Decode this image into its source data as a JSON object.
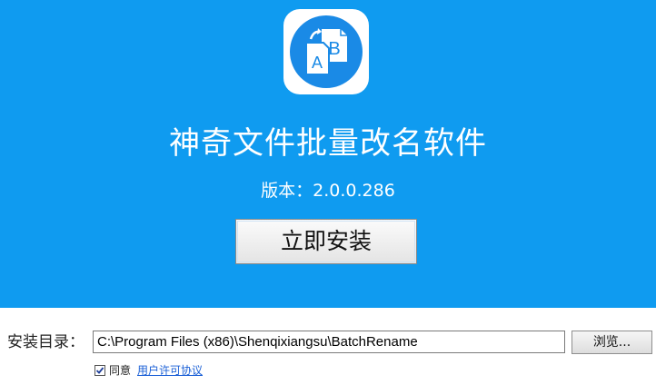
{
  "app": {
    "icon": "document-a-b-icon",
    "title": "神奇文件批量改名软件",
    "version": "版本：2.0.0.286"
  },
  "actions": {
    "install_label": "立即安装"
  },
  "install_dir": {
    "label": "安装目录：",
    "value": "C:\\Program Files (x86)\\Shenqixiangsu\\BatchRename",
    "browse_label": "浏览..."
  },
  "agreement": {
    "checked": true,
    "label": "同意",
    "link_text": "用户许可协议"
  },
  "colors": {
    "hero_background": "#0f9bf0",
    "icon_blue": "#1a8ae6",
    "link": "#1a5fd6"
  }
}
